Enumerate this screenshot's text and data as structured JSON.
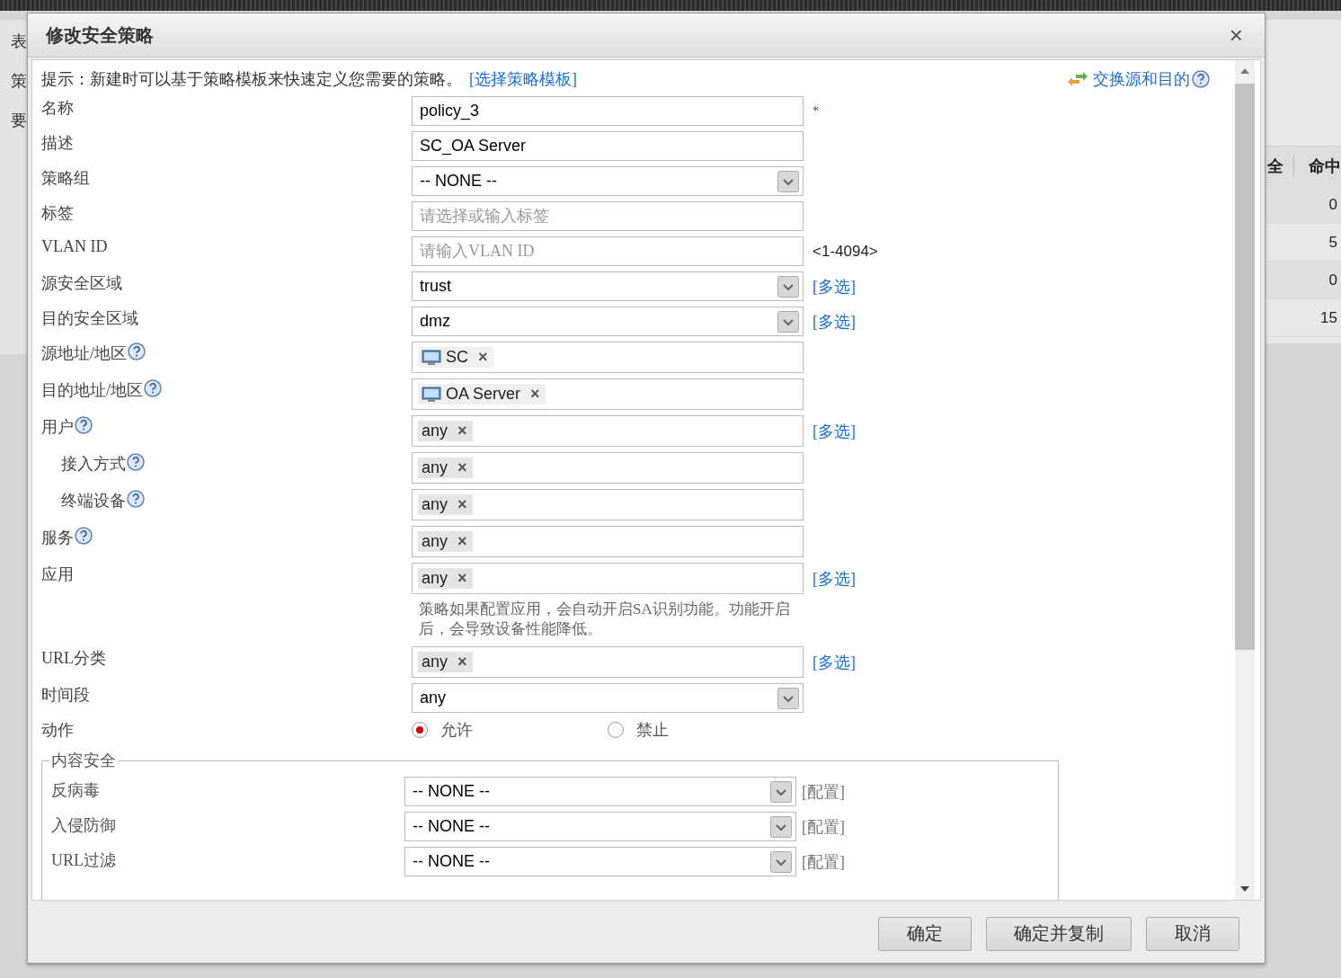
{
  "background": {
    "left_texts": [
      "表",
      "策",
      "要"
    ],
    "table": {
      "columns": [
        "全",
        "命中"
      ],
      "rows": [
        [
          "",
          "0"
        ],
        [
          "",
          "5"
        ],
        [
          "",
          "0"
        ],
        [
          "",
          "15"
        ]
      ]
    }
  },
  "dialog": {
    "title": "修改安全策略",
    "close": "×",
    "hint": {
      "text": "提示：新建时可以基于策略模板来快速定义您需要的策略。",
      "link": "[选择策略模板]"
    },
    "swap_link": "交换源和目的",
    "remove_tag": "×",
    "fields": [
      {
        "kind": "text",
        "label": "名称",
        "value": "policy_3",
        "required": "*"
      },
      {
        "kind": "text",
        "label": "描述",
        "value": "SC_OA Server"
      },
      {
        "kind": "select",
        "label": "策略组",
        "value": "-- NONE --"
      },
      {
        "kind": "text",
        "label": "标签",
        "placeholder": "请选择或输入标签"
      },
      {
        "kind": "text",
        "label": "VLAN ID",
        "placeholder": "请输入VLAN ID",
        "suffix": "<1-4094>"
      },
      {
        "kind": "select",
        "label": "源安全区域",
        "value": "trust",
        "link": "[多选]"
      },
      {
        "kind": "select",
        "label": "目的安全区域",
        "value": "dmz",
        "link": "[多选]"
      },
      {
        "kind": "tags",
        "label": "源地址/地区",
        "help": true,
        "tags": [
          {
            "label": "SC",
            "kind": "host"
          }
        ]
      },
      {
        "kind": "tags",
        "label": "目的地址/地区",
        "help": true,
        "tags": [
          {
            "label": "OA Server",
            "kind": "host"
          }
        ]
      },
      {
        "kind": "tags",
        "label": "用户",
        "help": true,
        "tags": [
          {
            "label": "any",
            "kind": "plain"
          }
        ],
        "link": "[多选]"
      },
      {
        "kind": "tags",
        "label": "接入方式",
        "help": true,
        "indent": true,
        "tags": [
          {
            "label": "any",
            "kind": "plain"
          }
        ]
      },
      {
        "kind": "tags",
        "label": "终端设备",
        "help": true,
        "indent": true,
        "tags": [
          {
            "label": "any",
            "kind": "plain"
          }
        ]
      },
      {
        "kind": "tags",
        "label": "服务",
        "help": true,
        "tags": [
          {
            "label": "any",
            "kind": "plain"
          }
        ]
      },
      {
        "kind": "tags",
        "label": "应用",
        "tags": [
          {
            "label": "any",
            "kind": "plain"
          }
        ],
        "link": "[多选]",
        "note": "策略如果配置应用，会自动开启SA识别功能。功能开启后，会导致设备性能降低。"
      },
      {
        "kind": "tags",
        "label": "URL分类",
        "tags": [
          {
            "label": "any",
            "kind": "plain"
          }
        ],
        "link": "[多选]"
      },
      {
        "kind": "select",
        "label": "时间段",
        "value": "any"
      },
      {
        "kind": "radio",
        "label": "动作",
        "options": [
          {
            "label": "允许",
            "selected": true
          },
          {
            "label": "禁止",
            "selected": false
          }
        ]
      }
    ],
    "content_security": {
      "title": "内容安全",
      "rows": [
        {
          "label": "反病毒",
          "value": "-- NONE --",
          "link": "[配置]"
        },
        {
          "label": "入侵防御",
          "value": "-- NONE --",
          "link": "[配置]"
        },
        {
          "label": "URL过滤",
          "value": "-- NONE --",
          "link": "[配置]"
        }
      ]
    },
    "buttons": [
      "确定",
      "确定并复制",
      "取消"
    ]
  }
}
